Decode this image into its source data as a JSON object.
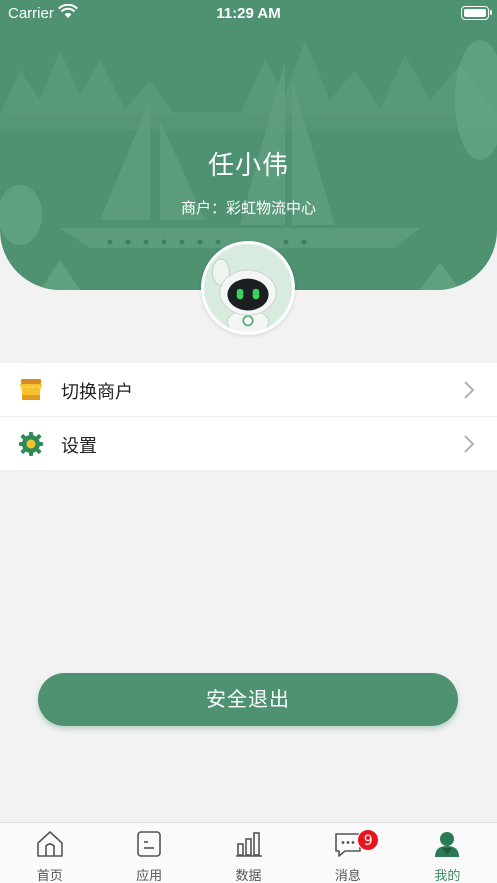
{
  "status_bar": {
    "carrier": "Carrier",
    "time": "11:29 AM"
  },
  "profile": {
    "name": "任小伟",
    "merchant_line": "商户：彩虹物流中心"
  },
  "menu": {
    "items": [
      {
        "label": "切换商户",
        "icon": "store-icon"
      },
      {
        "label": "设置",
        "icon": "gear-icon"
      }
    ]
  },
  "logout": {
    "label": "安全退出"
  },
  "tabbar": {
    "items": [
      {
        "label": "首页",
        "icon": "home-icon"
      },
      {
        "label": "应用",
        "icon": "app-icon"
      },
      {
        "label": "数据",
        "icon": "data-icon"
      },
      {
        "label": "消息",
        "icon": "message-icon",
        "badge": "9"
      },
      {
        "label": "我的",
        "icon": "profile-icon",
        "active": true
      }
    ]
  },
  "colors": {
    "brand": "#4e9271",
    "badge": "#e8151e",
    "store_yellow": "#f6c22b",
    "gear_green": "#2e8b57"
  }
}
